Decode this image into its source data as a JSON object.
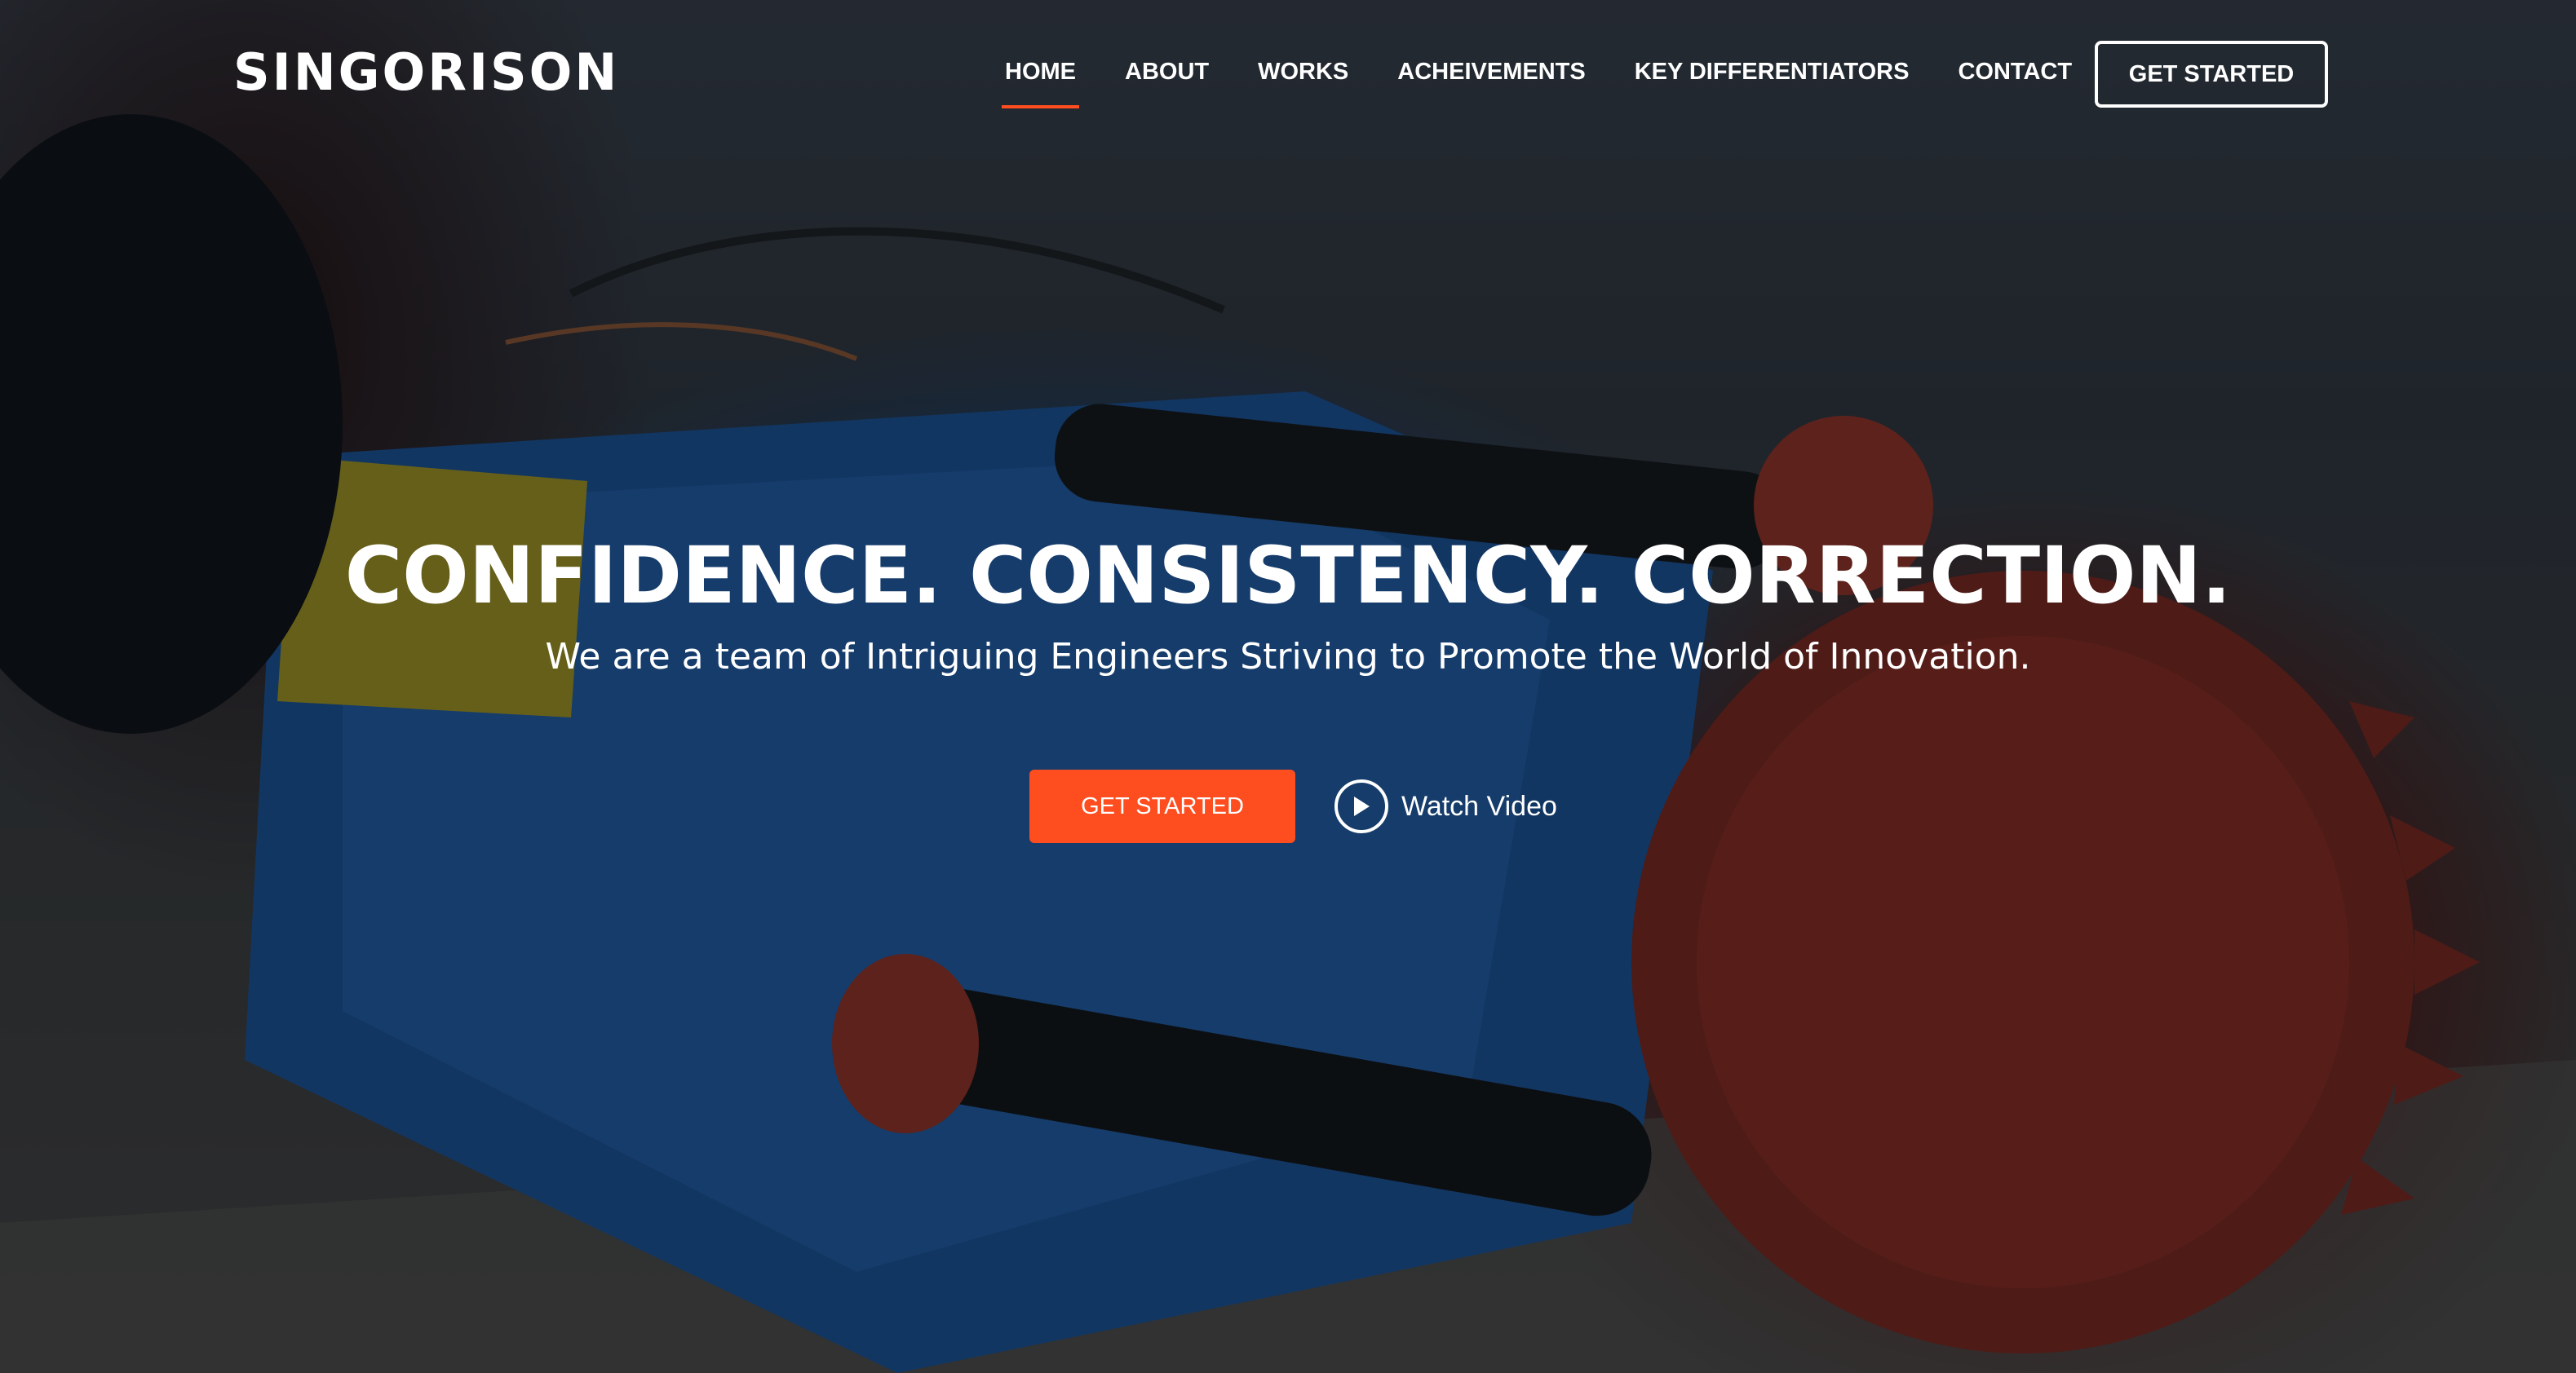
{
  "brand": {
    "name": "SINGORISON"
  },
  "nav": {
    "items": [
      {
        "label": "HOME",
        "active": true
      },
      {
        "label": "ABOUT",
        "active": false
      },
      {
        "label": "WORKS",
        "active": false
      },
      {
        "label": "ACHEIVEMENTS",
        "active": false
      },
      {
        "label": "KEY DIFFERENTIATORS",
        "active": false
      },
      {
        "label": "CONTACT",
        "active": false
      }
    ],
    "cta_label": "GET STARTED"
  },
  "hero": {
    "headline": "CONFIDENCE. CONSISTENCY. CORRECTION.",
    "subheadline": "We are a team of Intriguing Engineers Striving to Promote the World of Innovation.",
    "primary_cta": "GET STARTED",
    "video_cta": "Watch Video"
  },
  "icons": {
    "video": "play-circle-icon"
  },
  "colors": {
    "accent": "#fe4d1e",
    "text": "#ffffff",
    "overlay": "#0a0e14"
  }
}
